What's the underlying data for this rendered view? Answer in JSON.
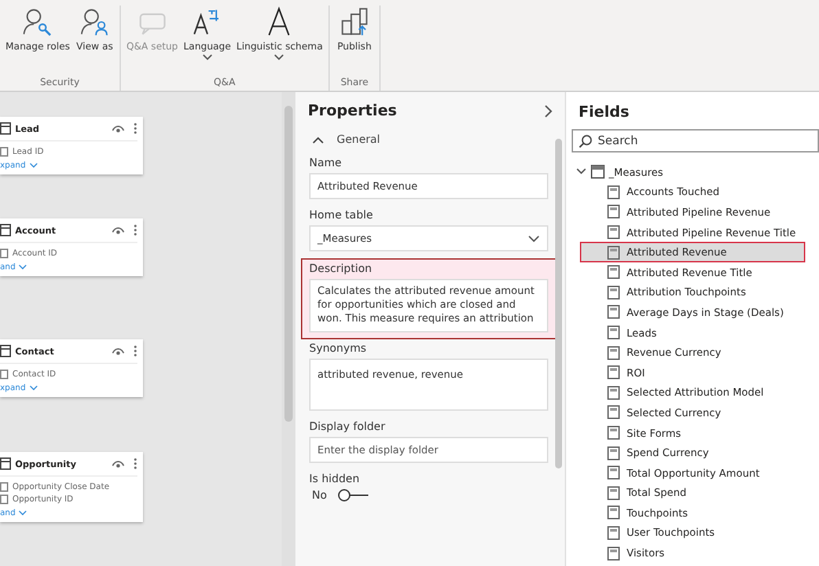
{
  "ribbon": {
    "groups": [
      {
        "label": "Security",
        "buttons": [
          {
            "kind": "roles",
            "label": "Manage roles",
            "disabled": false,
            "menu": false
          },
          {
            "kind": "viewas",
            "label": "View as",
            "disabled": false,
            "menu": false
          }
        ]
      },
      {
        "label": "Q&A",
        "buttons": [
          {
            "kind": "qna",
            "label": "Q&A setup",
            "disabled": true,
            "menu": false
          },
          {
            "kind": "language",
            "label": "Language",
            "disabled": false,
            "menu": true
          },
          {
            "kind": "schema",
            "label": "Linguistic schema",
            "disabled": false,
            "menu": true
          }
        ]
      },
      {
        "label": "Share",
        "buttons": [
          {
            "kind": "publish",
            "label": "Publish",
            "disabled": false,
            "menu": false
          }
        ]
      }
    ]
  },
  "canvas": {
    "tables": [
      {
        "title": "Lead",
        "fields": [
          "Lead ID"
        ],
        "expand": "xpand"
      },
      {
        "title": "Account",
        "fields": [
          "Account ID"
        ],
        "expand": "and"
      },
      {
        "title": "Contact",
        "fields": [
          "Contact ID"
        ],
        "expand": "xpand"
      },
      {
        "title": "Opportunity",
        "fields": [
          "Opportunity Close Date",
          "Opportunity ID"
        ],
        "expand": "and"
      }
    ]
  },
  "properties": {
    "title": "Properties",
    "section": "General",
    "expanded": true,
    "name": {
      "label": "Name",
      "value": "Attributed Revenue"
    },
    "home_table": {
      "label": "Home table",
      "value": "_Measures"
    },
    "description": {
      "label": "Description",
      "value": "Calculates the attributed revenue amount for opportunities which are closed and won.  This measure requires an attribution",
      "highlighted": true
    },
    "synonyms": {
      "label": "Synonyms",
      "value": "attributed revenue, revenue"
    },
    "display_folder": {
      "label": "Display folder",
      "placeholder": "Enter the display folder"
    },
    "is_hidden": {
      "label": "Is hidden",
      "state": "No",
      "on": false
    }
  },
  "fields": {
    "title": "Fields",
    "search": {
      "placeholder": "Search"
    },
    "tree": [
      {
        "label": "_Measures",
        "expanded": true,
        "children": [
          {
            "label": "Accounts Touched",
            "selected": false
          },
          {
            "label": "Attributed Pipeline Revenue",
            "selected": false
          },
          {
            "label": "Attributed Pipeline Revenue Title",
            "selected": false
          },
          {
            "label": "Attributed Revenue",
            "selected": true
          },
          {
            "label": "Attributed Revenue Title",
            "selected": false
          },
          {
            "label": "Attribution Touchpoints",
            "selected": false
          },
          {
            "label": "Average Days in Stage (Deals)",
            "selected": false
          },
          {
            "label": "Leads",
            "selected": false
          },
          {
            "label": "Revenue Currency",
            "selected": false
          },
          {
            "label": "ROI",
            "selected": false
          },
          {
            "label": "Selected Attribution Model",
            "selected": false
          },
          {
            "label": "Selected Currency",
            "selected": false
          },
          {
            "label": "Site Forms",
            "selected": false
          },
          {
            "label": "Spend Currency",
            "selected": false
          },
          {
            "label": "Total Opportunity Amount",
            "selected": false
          },
          {
            "label": "Total Spend",
            "selected": false
          },
          {
            "label": "Touchpoints",
            "selected": false
          },
          {
            "label": "User Touchpoints",
            "selected": false
          },
          {
            "label": "Visitors",
            "selected": false
          }
        ]
      }
    ]
  }
}
